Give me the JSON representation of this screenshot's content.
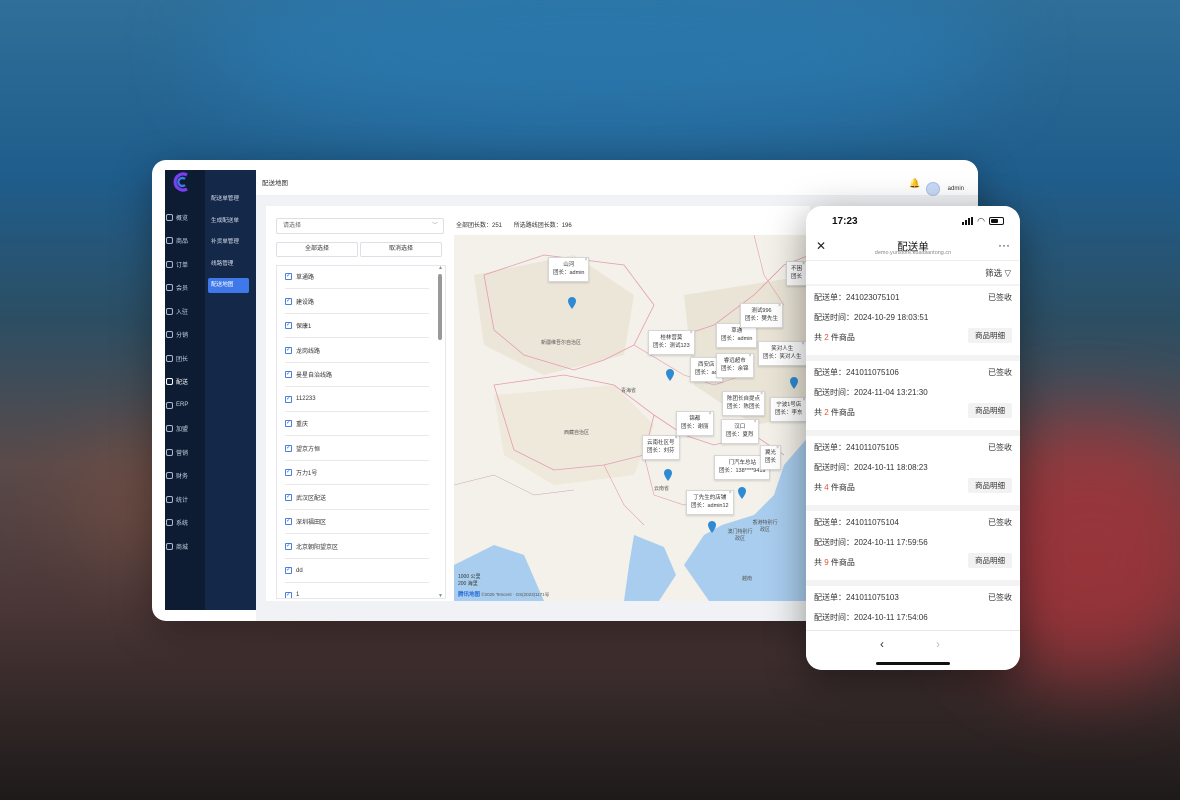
{
  "desktop": {
    "page_title": "配送地图",
    "user": "admin",
    "rail": [
      "概览",
      "商品",
      "订单",
      "会员",
      "入驻",
      "分销",
      "团长",
      "配送",
      "ERP",
      "加盟",
      "营销",
      "财务",
      "统计",
      "系统",
      "商城"
    ],
    "rail_active": "配送",
    "submenu": [
      "配送单管理",
      "生成配送单",
      "补货单管理",
      "线路管理",
      "配送地图"
    ],
    "submenu_active": "配送地图",
    "select_placeholder": "请选择",
    "btn_select_all": "全部选择",
    "btn_cancel_select": "取消选择",
    "stats": {
      "total": "全部团长数：251",
      "selected": "所选路线团长数：196"
    },
    "routes": [
      "草通路",
      "建设路",
      "保康1",
      "龙岗线路",
      "曼星自治线路",
      "112233",
      "重庆",
      "望京方恒",
      "万力1号",
      "武汉区配送",
      "深圳福田区",
      "北京朝阳望京区",
      "dd",
      "1"
    ],
    "map": {
      "popups": [
        {
          "name": "山河",
          "leader": "团长：admin"
        },
        {
          "name": "桂林营莫",
          "leader": "团长：测试123"
        },
        {
          "name": "草通",
          "leader": "团长：admin"
        },
        {
          "name": "测试996",
          "leader": "团长：樊先生"
        },
        {
          "name": "笑对人生",
          "leader": "团长：笑对人生"
        },
        {
          "name": "丁先生的店铺",
          "leader": "团长：admin12"
        },
        {
          "name": "门汽车总站",
          "leader": "团长：138****9419"
        },
        {
          "name": "云南社区号",
          "leader": "团长：刘芬"
        },
        {
          "name": "西安店",
          "leader": "团长：ad"
        },
        {
          "name": "睿远超市",
          "leader": "团长：余锦"
        },
        {
          "name": "宁波1号店",
          "leader": "团长：李东"
        },
        {
          "name": "陈团长自提点",
          "leader": "团长：陈团长"
        },
        {
          "name": "锦都",
          "leader": "团长：谢丽"
        },
        {
          "name": "汉口",
          "leader": "团长：夏烈"
        },
        {
          "name": "不困",
          "leader": "团长"
        },
        {
          "name": "翼光",
          "leader": "团长"
        }
      ],
      "places": [
        "新疆维吾尔自治区",
        "西藏自治区",
        "青海省",
        "云南省",
        "澳门特别行政区",
        "香港特别行政区",
        "越南"
      ],
      "scale": [
        "1000 公里",
        "200 海里"
      ],
      "copyright_brand": "腾讯地图",
      "copyright": "©2025 Tencent · GS(2023)1171号"
    }
  },
  "phone": {
    "time": "17:23",
    "title": "配送单",
    "url": "demo.yunstore.kuaidiantong.cn",
    "filter": "筛选",
    "orders": [
      {
        "no": "配送单：241023075101",
        "status": "已签收",
        "time": "配送时间：2024-10-29 18:03:51",
        "count_pre": "共 ",
        "count": "2",
        "count_post": " 件商品",
        "detail": "商品明细"
      },
      {
        "no": "配送单：241011075106",
        "status": "已签收",
        "time": "配送时间：2024-11-04 13:21:30",
        "count_pre": "共 ",
        "count": "2",
        "count_post": " 件商品",
        "detail": "商品明细"
      },
      {
        "no": "配送单：241011075105",
        "status": "已签收",
        "time": "配送时间：2024-10-11 18:08:23",
        "count_pre": "共 ",
        "count": "4",
        "count_post": " 件商品",
        "detail": "商品明细"
      },
      {
        "no": "配送单：241011075104",
        "status": "已签收",
        "time": "配送时间：2024-10-11 17:59:56",
        "count_pre": "共 ",
        "count": "9",
        "count_post": " 件商品",
        "detail": "商品明细"
      },
      {
        "no": "配送单：241011075103",
        "status": "已签收",
        "time": "配送时间：2024-10-11 17:54:06"
      }
    ]
  },
  "colors": {
    "brand": "#7b3ff2",
    "sidebar": "#0d1c33",
    "active": "#3f78e8",
    "count": "#e5533a"
  }
}
